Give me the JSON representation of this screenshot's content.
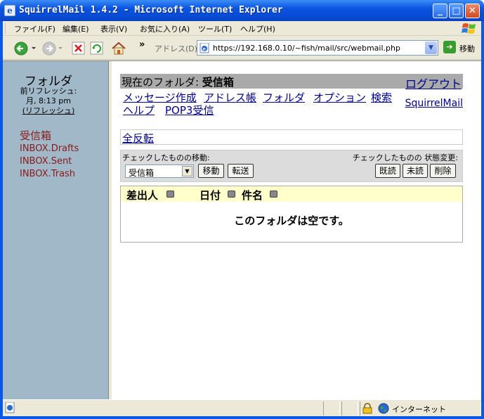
{
  "window": {
    "title": "SquirrelMail 1.4.2 - Microsoft Internet Explorer",
    "minimize": "_",
    "maximize": "□",
    "close": "✕"
  },
  "menubar": {
    "items": [
      "ファイル(F)",
      "編集(E)",
      "表示(V)",
      "お気に入り(A)",
      "ツール(T)",
      "ヘルプ(H)"
    ]
  },
  "toolbar": {
    "more": "»",
    "address_label": "アドレス(D)",
    "url": "https://192.168.0.10/~fish/mail/src/webmail.php",
    "go_label": "移動"
  },
  "sidebar": {
    "title": "フォルダ",
    "refresh_line1": "前リフレッシュ:",
    "refresh_line2": "月, 8:13 pm",
    "refresh_link": "(リフレッシュ)",
    "folders": [
      "受信箱",
      "INBOX.Drafts",
      "INBOX.Sent",
      "INBOX.Trash"
    ]
  },
  "main": {
    "current_folder_label": "現在のフォルダ:",
    "current_folder_name": "受信箱",
    "logout": "ログアウト",
    "nav": [
      "メッセージ作成",
      "アドレス帳",
      "フォルダ",
      "オプション",
      "検索",
      "ヘルプ",
      "POP3受信"
    ],
    "squirrelmail_link": "SquirrelMail",
    "toggle_all": "全反転",
    "move_label": "チェックしたものの移動:",
    "status_label": "チェックしたものの 状態変更:",
    "move_select": "受信箱",
    "buttons": {
      "move": "移動",
      "forward": "転送",
      "read": "既読",
      "unread": "未読",
      "delete": "削除"
    },
    "columns": [
      "差出人",
      "日付",
      "件名"
    ],
    "empty_message": "このフォルダは空です。"
  },
  "statusbar": {
    "zone": "インターネット"
  },
  "colors": {
    "titlebar": "#0a54e0",
    "sidebar_bg": "#a0b8c8",
    "folder_text": "#8b1a1a",
    "link": "#00008b",
    "header_bg": "#ffffcc"
  }
}
